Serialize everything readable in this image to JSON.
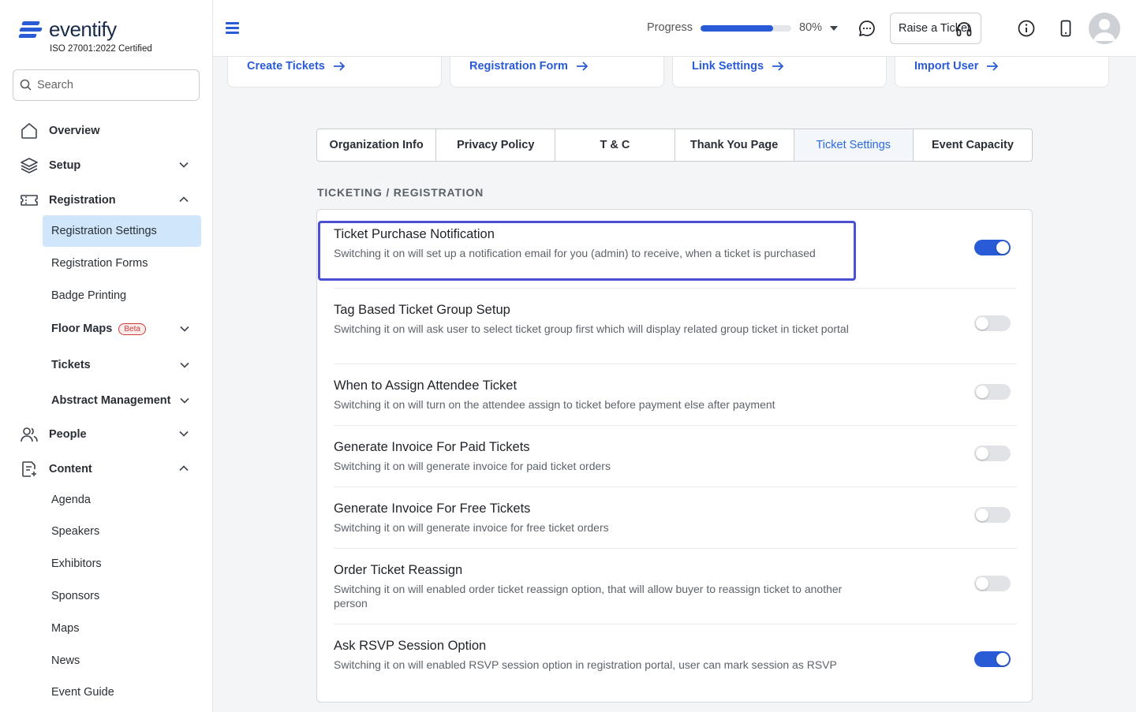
{
  "brand": {
    "name": "eventify",
    "certification": "ISO 27001:2022 Certified",
    "accent": "#2a5bd7"
  },
  "search": {
    "placeholder": "Search"
  },
  "nav": {
    "overview": "Overview",
    "setup": "Setup",
    "registration": "Registration",
    "registration_sub": {
      "settings": "Registration Settings",
      "forms": "Registration Forms",
      "badge": "Badge Printing",
      "floor_maps": "Floor Maps",
      "floor_maps_badge": "Beta",
      "tickets": "Tickets",
      "abstract": "Abstract Management"
    },
    "people": "People",
    "content": "Content",
    "content_sub": [
      "Agenda",
      "Speakers",
      "Exhibitors",
      "Sponsors",
      "Maps",
      "News",
      "Event Guide"
    ]
  },
  "topbar": {
    "progress_label": "Progress",
    "progress_value": 0.8,
    "progress_text": "80%",
    "raise_ticket": "Raise a Ticket",
    "icons": [
      "chat-icon",
      "headset-icon",
      "info-icon",
      "mobile-icon",
      "user-avatar-icon"
    ]
  },
  "quick_links": [
    "Create Tickets",
    "Registration Form",
    "Link Settings",
    "Import User"
  ],
  "tabs": [
    "Organization Info",
    "Privacy Policy",
    "T & C",
    "Thank You Page",
    "Ticket Settings",
    "Event Capacity"
  ],
  "active_tab": "Ticket Settings",
  "section_title": "TICKETING / REGISTRATION",
  "settings": [
    {
      "title": "Ticket Purchase Notification",
      "desc": "Switching it on will set up a notification email for you (admin) to receive, when a ticket is purchased",
      "on": true
    },
    {
      "title": "Tag Based Ticket Group Setup",
      "desc": "Switching it on will ask user to select ticket group first which will display related group ticket in ticket portal",
      "on": false
    },
    {
      "title": "When to Assign Attendee Ticket",
      "desc": "Switching it on will turn on the attendee assign to ticket before payment else after payment",
      "on": false
    },
    {
      "title": "Generate Invoice For Paid Tickets",
      "desc": "Switching it on will generate invoice for paid ticket orders",
      "on": false
    },
    {
      "title": "Generate Invoice For Free Tickets",
      "desc": "Switching it on will generate invoice for free ticket orders",
      "on": false
    },
    {
      "title": "Order Ticket Reassign",
      "desc": "Switching it on will enabled order ticket reassign option, that will allow buyer to reassign ticket to another person",
      "on": false
    },
    {
      "title": "Ask RSVP Session Option",
      "desc": "Switching it on will enabled RSVP session option in registration portal, user can mark session as RSVP",
      "on": true
    }
  ]
}
